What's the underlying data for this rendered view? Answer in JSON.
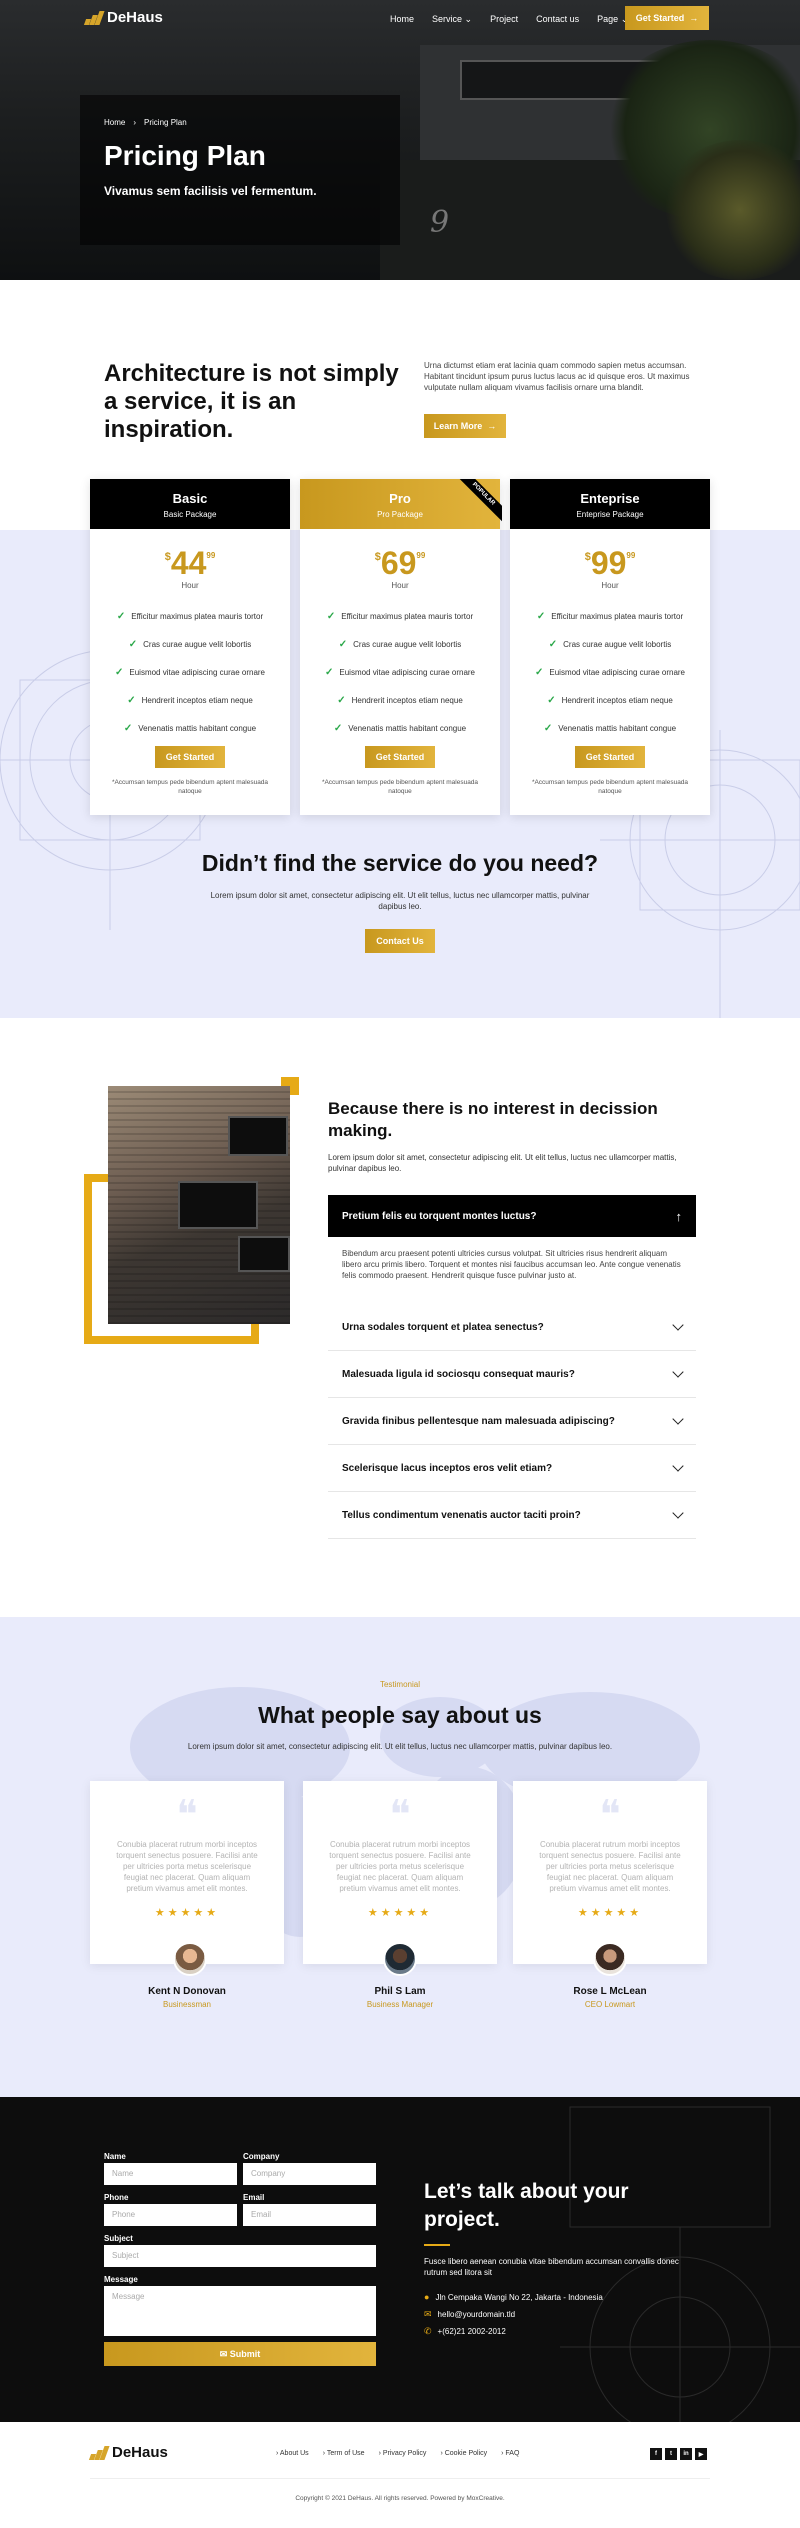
{
  "nav": {
    "logo": "DeHaus",
    "links": [
      "Home",
      "Service",
      "Project",
      "Contact us",
      "Page"
    ],
    "cta": "Get Started"
  },
  "hero": {
    "breadcrumb_home": "Home",
    "breadcrumb_current": "Pricing Plan",
    "title": "Pricing Plan",
    "subtitle": "Vivamus sem facilisis vel fermentum.",
    "house_number": "9"
  },
  "intro": {
    "heading": "Architecture is not simply a service, it is an inspiration.",
    "text": "Urna dictumst etiam erat lacinia quam commodo sapien metus accumsan. Habitant tincidunt ipsum purus luctus lacus ac id quisque eros. Ut maximus vulputate nullam aliquam vivamus facilisis ornare urna blandit.",
    "button": "Learn More"
  },
  "pricing": {
    "features": [
      "Efficitur maximus platea mauris tortor",
      "Cras curae augue velit lobortis",
      "Euismod vitae adipiscing curae ornare",
      "Hendrerit inceptos etiam neque",
      "Venenatis mattis habitant congue"
    ],
    "note": "*Accumsan tempus pede bibendum aptent malesuada natoque",
    "plans": [
      {
        "name": "Basic",
        "package": "Basic Package",
        "currency": "$",
        "amount": "44",
        "cents": "99",
        "unit": "Hour",
        "button": "Get Started"
      },
      {
        "name": "Pro",
        "package": "Pro Package",
        "currency": "$",
        "amount": "69",
        "cents": "99",
        "unit": "Hour",
        "button": "Get Started",
        "badge": "POPULAR"
      },
      {
        "name": "Enteprise",
        "package": "Enteprise Package",
        "currency": "$",
        "amount": "99",
        "cents": "99",
        "unit": "Hour",
        "button": "Get Started"
      }
    ]
  },
  "notfound": {
    "heading": "Didn’t find the service do you need?",
    "text": "Lorem ipsum dolor sit amet, consectetur adipiscing elit. Ut elit tellus, luctus nec ullamcorper mattis, pulvinar dapibus leo.",
    "button": "Contact Us"
  },
  "faq": {
    "heading": "Because there is no interest in decission making.",
    "text": "Lorem ipsum dolor sit amet, consectetur adipiscing elit. Ut elit tellus, luctus nec ullamcorper mattis, pulvinar dapibus leo.",
    "open_question": "Pretium felis eu torquent montes luctus?",
    "open_answer": "Bibendum arcu praesent potenti ultricies cursus volutpat. Sit ultricies risus hendrerit aliquam libero arcu primis libero. Torquent et montes nisi faucibus accumsan leo. Ante congue venenatis felis commodo praesent. Hendrerit quisque fusce pulvinar justo at.",
    "questions": [
      "Urna sodales torquent et platea senectus?",
      "Malesuada ligula id sociosqu consequat mauris?",
      "Gravida finibus pellentesque nam malesuada adipiscing?",
      "Scelerisque lacus inceptos eros velit etiam?",
      "Tellus condimentum venenatis auctor taciti proin?"
    ]
  },
  "testimonials": {
    "tag": "Testimonial",
    "heading": "What people say about us",
    "text": "Lorem ipsum dolor sit amet, consectetur adipiscing elit. Ut elit tellus, luctus nec ullamcorper mattis, pulvinar dapibus leo.",
    "quote": "Conubia placerat rutrum morbi inceptos torquent senectus posuere. Facilisi ante per ultricies porta metus scelerisque feugiat nec placerat. Quam aliquam pretium vivamus amet elit montes.",
    "stars": "★★★★★",
    "items": [
      {
        "name": "Kent N Donovan",
        "role": "Businessman"
      },
      {
        "name": "Phil S Lam",
        "role": "Business Manager"
      },
      {
        "name": "Rose L McLean",
        "role": "CEO Lowmart"
      }
    ]
  },
  "contact": {
    "fields": {
      "name_label": "Name",
      "name_placeholder": "Name",
      "company_label": "Company",
      "company_placeholder": "Company",
      "phone_label": "Phone",
      "phone_placeholder": "Phone",
      "email_label": "Email",
      "email_placeholder": "Email",
      "subject_label": "Subject",
      "subject_placeholder": "Subject",
      "message_label": "Message",
      "message_placeholder": "Message"
    },
    "submit": "Submit",
    "heading": "Let’s talk about your project.",
    "text": "Fusce libero aenean conubia vitae bibendum accumsan convallis donec rutrum sed litora sit",
    "address": "Jln Cempaka Wangi No 22, Jakarta - Indonesia",
    "email": "hello@yourdomain.tld",
    "phone": "+(62)21 2002-2012"
  },
  "footer": {
    "logo": "DeHaus",
    "links": [
      "About Us",
      "Term of Use",
      "Privacy Policy",
      "Cookie Policy",
      "FAQ"
    ],
    "social": [
      "f",
      "t",
      "in",
      "▶"
    ],
    "copyright": "Copyright © 2021 DeHaus. All rights reserved. Powered by MoxCreative."
  },
  "colors": {
    "accent": "#c8981e",
    "accent_light": "#e6aa16",
    "dark": "#0d0d0d",
    "lavender": "#e9ebfb"
  }
}
